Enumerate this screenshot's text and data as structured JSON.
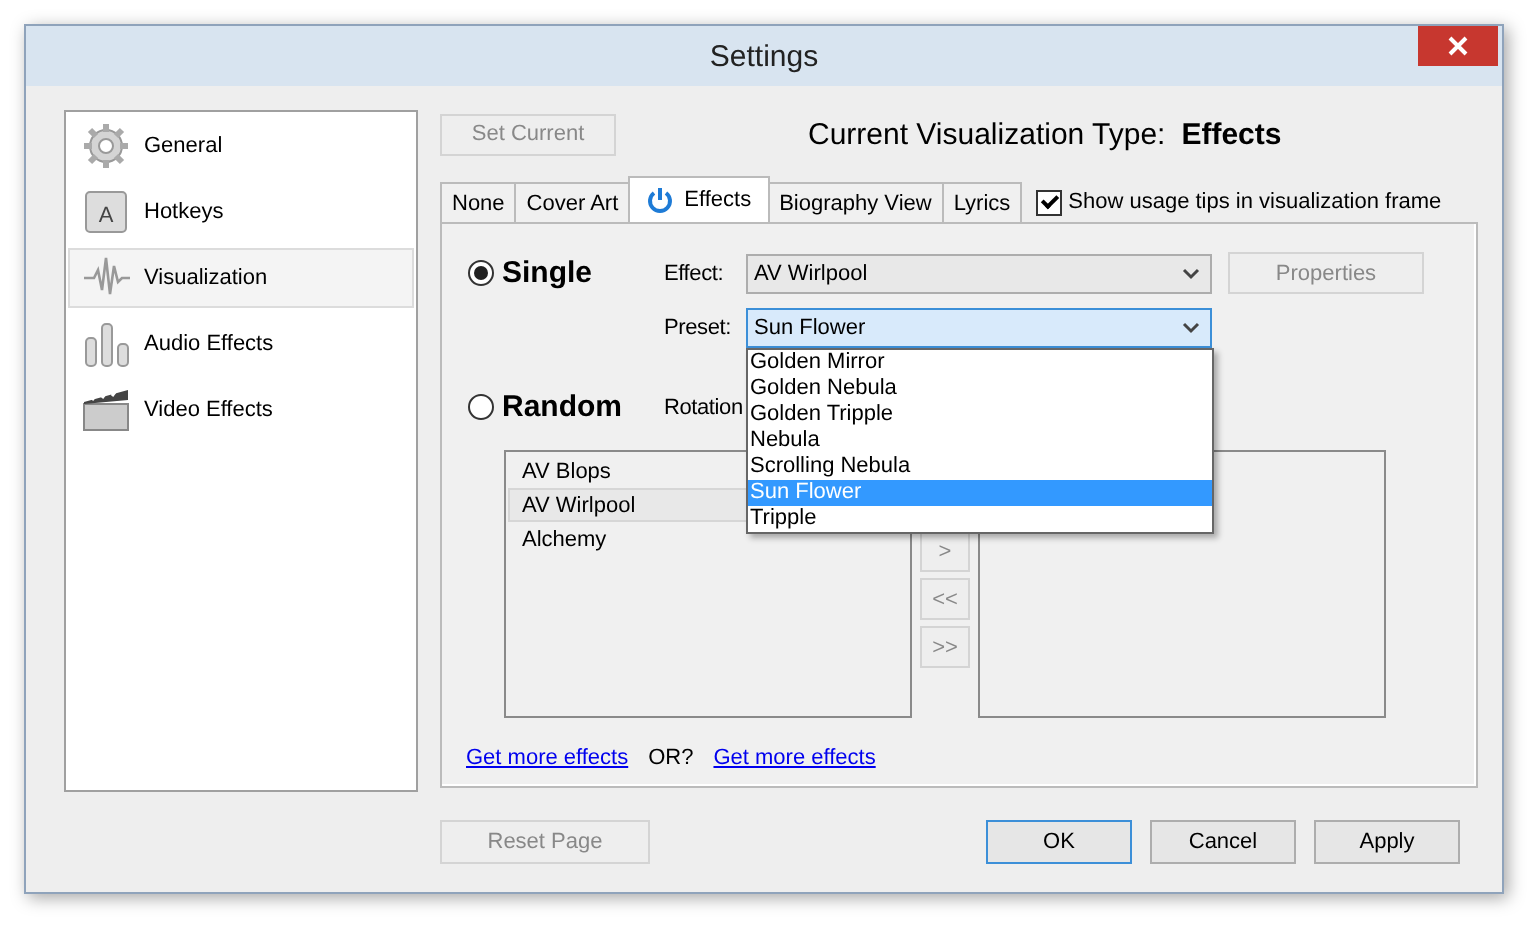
{
  "window": {
    "title": "Settings"
  },
  "sidebar": {
    "items": [
      {
        "label": "General",
        "kind": "gear",
        "selected": false
      },
      {
        "label": "Hotkeys",
        "kind": "key",
        "selected": false,
        "icon_letter": "A"
      },
      {
        "label": "Visualization",
        "kind": "wave",
        "selected": true
      },
      {
        "label": "Audio Effects",
        "kind": "bars",
        "selected": false
      },
      {
        "label": "Video Effects",
        "kind": "clapper",
        "selected": false
      }
    ]
  },
  "set_current_button": {
    "label": "Set Current",
    "disabled": true
  },
  "current_type": {
    "label": "Current Visualization Type:",
    "value": "Effects"
  },
  "tabs": [
    {
      "label": "None",
      "selected": false,
      "has_icon": false
    },
    {
      "label": "Cover Art",
      "selected": false,
      "has_icon": false
    },
    {
      "label": "Effects",
      "selected": true,
      "has_icon": true
    },
    {
      "label": "Biography View",
      "selected": false,
      "has_icon": false
    },
    {
      "label": "Lyrics",
      "selected": false,
      "has_icon": false
    }
  ],
  "show_tips": {
    "label": "Show usage tips in visualization frame",
    "checked": true
  },
  "mode_single": {
    "label": "Single",
    "selected": true
  },
  "mode_random": {
    "label": "Random",
    "selected": false
  },
  "effect": {
    "label": "Effect:",
    "value": "AV Wirlpool"
  },
  "properties_button": {
    "label": "Properties",
    "disabled": true
  },
  "preset": {
    "label": "Preset:",
    "value": "Sun Flower",
    "expanded": true,
    "options": [
      {
        "label": "Golden Mirror",
        "selected": false
      },
      {
        "label": "Golden Nebula",
        "selected": false
      },
      {
        "label": "Golden Tripple",
        "selected": false
      },
      {
        "label": "Nebula",
        "selected": false
      },
      {
        "label": "Scrolling Nebula",
        "selected": false
      },
      {
        "label": "Sun Flower",
        "selected": true
      },
      {
        "label": "Tripple",
        "selected": false
      }
    ]
  },
  "rotation": {
    "label": "Rotation"
  },
  "available_list": [
    {
      "label": "AV Blops",
      "selected": false
    },
    {
      "label": "AV Wirlpool",
      "selected": true
    },
    {
      "label": "Alchemy",
      "selected": false
    }
  ],
  "move_buttons": [
    {
      "label": ">",
      "disabled": true
    },
    {
      "label": "<<",
      "disabled": true
    },
    {
      "label": ">>",
      "disabled": true
    }
  ],
  "links": [
    {
      "kind": "link",
      "label": "Get more effects"
    },
    {
      "kind": "text",
      "label": "OR?"
    },
    {
      "kind": "link",
      "label": "Get more effects"
    }
  ],
  "reset_button": {
    "label": "Reset Page",
    "disabled": true
  },
  "buttons": [
    {
      "label": "OK",
      "default": true
    },
    {
      "label": "Cancel",
      "default": false
    },
    {
      "label": "Apply",
      "default": false
    }
  ]
}
